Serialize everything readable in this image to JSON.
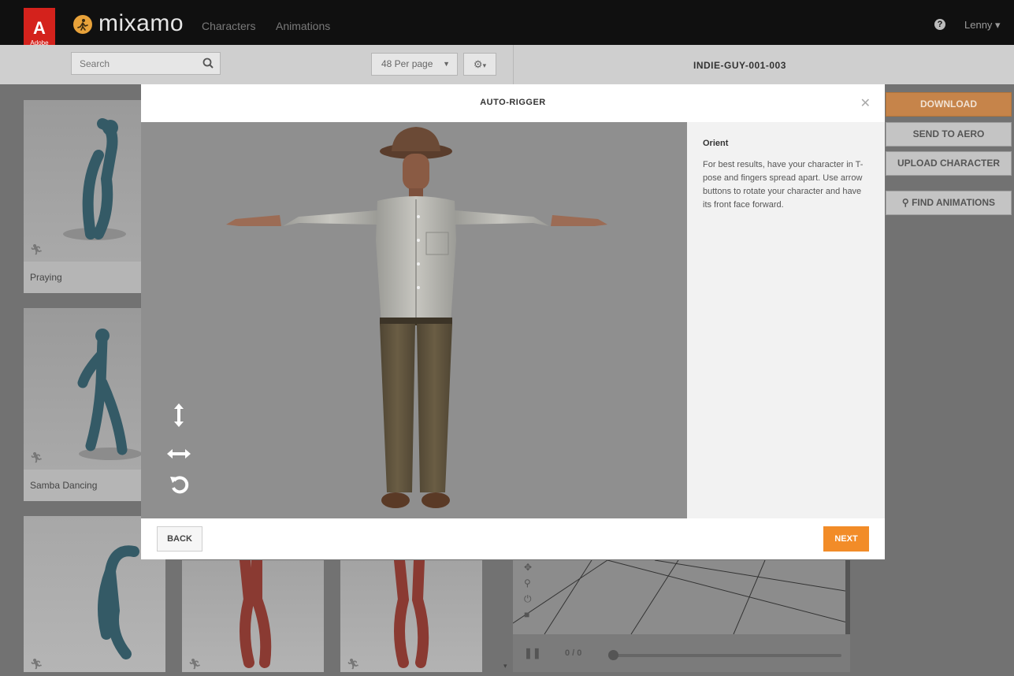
{
  "app": {
    "adobe_label": "Adobe",
    "logo": "mixamo",
    "nav": [
      "Characters",
      "Animations"
    ],
    "user": "Lenny"
  },
  "toolbar": {
    "search_placeholder": "Search",
    "per_page": "48 Per page",
    "character_name": "INDIE-GUY-001-003"
  },
  "cards": [
    {
      "label": "Praying"
    },
    {
      "label": "Samba Dancing"
    }
  ],
  "right_buttons": {
    "download": "DOWNLOAD",
    "send_to_aero": "SEND TO AERO",
    "upload_character": "UPLOAD CHARACTER",
    "find_animations": "FIND ANIMATIONS"
  },
  "player": {
    "time": "0 / 0"
  },
  "modal": {
    "title": "AUTO-RIGGER",
    "close_icon": "close-icon",
    "info_title": "Orient",
    "info_text": "For best results, have your character in T-pose and fingers spread apart. Use arrow buttons to rotate your character and have its front face forward.",
    "back_label": "BACK",
    "next_label": "NEXT",
    "controls": [
      "vertical-arrows-icon",
      "horizontal-arrows-icon",
      "rotate-icon"
    ]
  },
  "colors": {
    "accent": "#f28c28",
    "adobe_red": "#d4221c",
    "topbar": "#101010"
  }
}
